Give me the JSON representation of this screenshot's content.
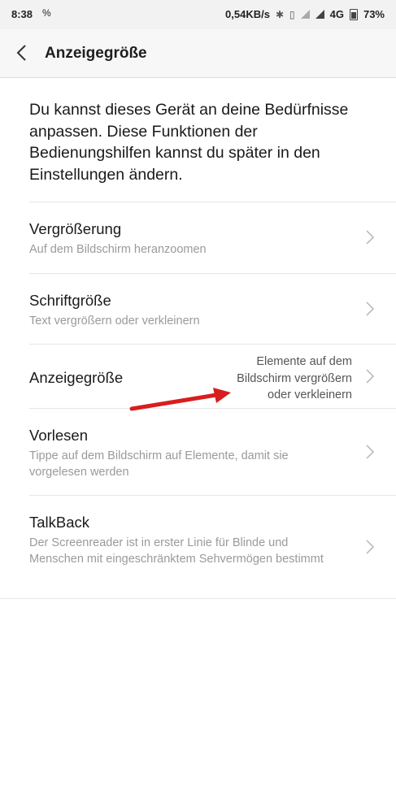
{
  "status_bar": {
    "time": "8:38",
    "notification_icon": "percent-icon",
    "speed": "0,54KB/s",
    "network": "4G",
    "battery": "73%"
  },
  "toolbar": {
    "title": "Anzeigegröße"
  },
  "intro": "Du kannst dieses Gerät an deine Bedürfnisse anpassen. Diese Funktionen der Bedienungshilfen kannst du später in den Einstellungen ändern.",
  "items": [
    {
      "label": "Vergrößerung",
      "sub": "Auf dem Bildschirm heranzoomen"
    },
    {
      "label": "Schriftgröße",
      "sub": "Text vergrößern oder verkleinern"
    },
    {
      "label": "Anzeigegröße",
      "summary": [
        "Elemente auf dem",
        "Bildschirm vergrößern",
        "oder verkleinern"
      ]
    },
    {
      "label": "Vorlesen",
      "sub": "Tippe auf dem Bildschirm auf Elemente, damit sie vorgelesen werden"
    },
    {
      "label": "TalkBack",
      "sub": "Der Screenreader ist in erster Linie für Blinde und Menschen mit eingeschränktem Sehvermögen bestimmt"
    }
  ],
  "colors": {
    "annotation_arrow": "#e02020",
    "secondary_text": "#9a9a9a"
  }
}
